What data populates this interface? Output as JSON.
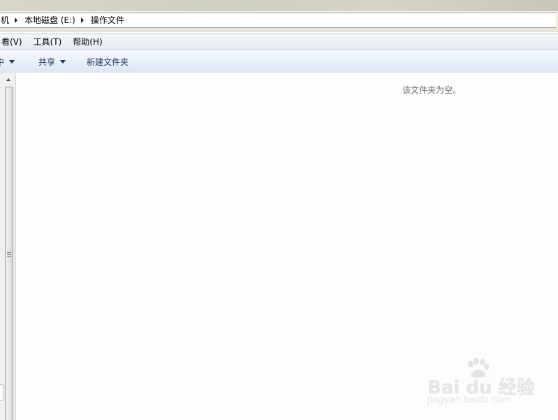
{
  "address_bar": {
    "crumbs": [
      "本地磁盘 (E:)",
      "操作文件"
    ],
    "partial_leading_crumb": "机"
  },
  "menu_bar": {
    "items": [
      "看(V)",
      "工具(T)",
      "帮助(H)"
    ]
  },
  "toolbar": {
    "include_label": "中",
    "share_label": "共享",
    "new_folder_label": "新建文件夹"
  },
  "content": {
    "empty_message": "该文件夹为空。"
  },
  "watermark": {
    "logo_text": "Bai du 经验",
    "url_text": "jingyan.baidu.com"
  },
  "colors": {
    "toolbar_text": "#1e395b",
    "empty_text": "#6d6d6d"
  }
}
